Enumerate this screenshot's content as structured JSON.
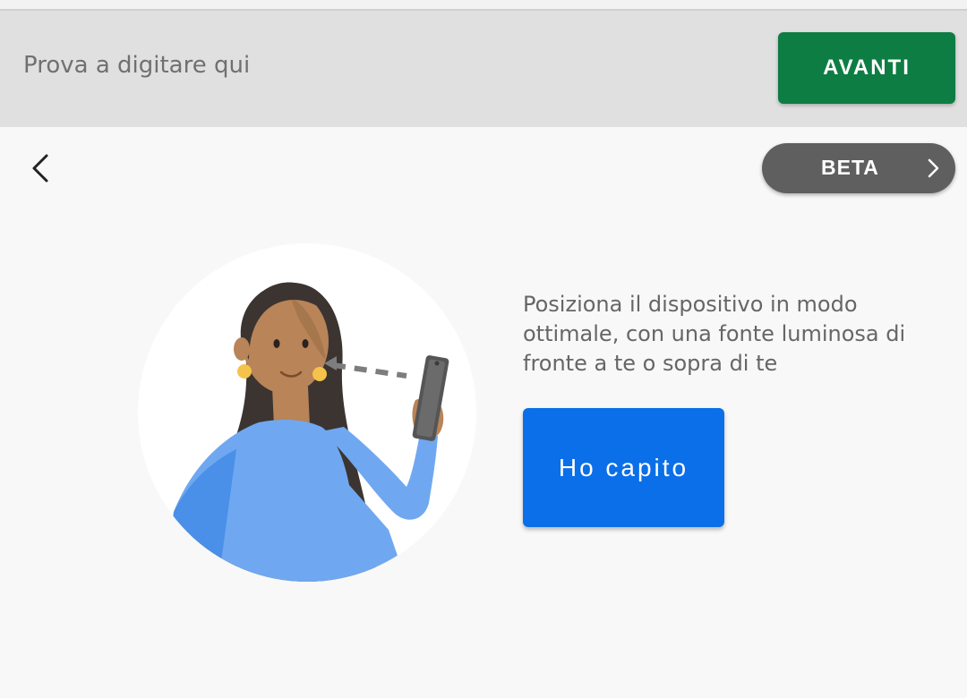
{
  "top_bar": {
    "input_text": "Prova a digitare qui",
    "next_button_label": "AVANTI"
  },
  "nav": {
    "back_icon": "chevron-left-icon",
    "beta_button_label": "BETA",
    "beta_icon": "chevron-right-icon"
  },
  "main": {
    "illustration": "woman-holding-phone-illustration",
    "instruction_text": "Posiziona il dispositivo in modo ottimale, con una fonte luminosa di fronte a te o sopra di te",
    "confirm_button_label": "Ho capito"
  },
  "colors": {
    "top_bar_bg": "#e0e0e0",
    "next_button_bg": "#0d7d43",
    "beta_button_bg": "#5f5f5f",
    "confirm_button_bg": "#0a6fe8",
    "page_bg": "#f8f8f8"
  }
}
